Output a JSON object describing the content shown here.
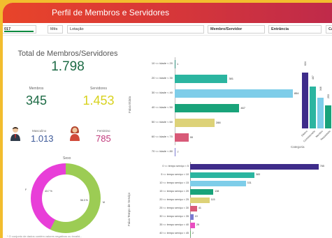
{
  "header": {
    "title": "Perfil de Membros e Servidores"
  },
  "filters": {
    "year_value": "017",
    "mes_label": "Mês",
    "lotacao_label": "Lotação",
    "membro_label": "Membro/Servidor",
    "entrancia_label": "Entrância",
    "cargo_label": "Ca"
  },
  "kpis": {
    "total_title": "Total de Membros/Servidores",
    "total_value": "1.798",
    "membros_label": "Membros",
    "membros_value": "345",
    "servidores_label": "Servidores",
    "servidores_value": "1.453",
    "masculino_label": "Masculino",
    "masculino_value": "1.013",
    "feminino_label": "Feminino",
    "feminino_value": "785"
  },
  "sexo": {
    "title": "Sexo",
    "f_label": "F",
    "m_label": "M",
    "f_pct": "43.7 %",
    "m_pct": "56.3 %",
    "colors": {
      "M": "#9ccc54",
      "F": "#e83ed8"
    }
  },
  "footnote": "* O conjunto de dados contém valores negativos ou invalid...",
  "chart_data": [
    {
      "type": "bar",
      "orientation": "horizontal",
      "ylabel": "Faixa Etária",
      "categories": [
        "10 <= idade < 20",
        "20 <= idade < 30",
        "30 <= idade < 40",
        "40 <= idade < 50",
        "50 <= idade < 60",
        "60 <= idade < 70",
        "70 <= idade < 80"
      ],
      "values": [
        1,
        381,
        854,
        467,
        288,
        99,
        7
      ],
      "colors": [
        "#2e8b7a",
        "#2bb5a0",
        "#7ecde9",
        "#19a37a",
        "#ddd278",
        "#d85a78",
        "#7a7ad0"
      ],
      "xlim": [
        0,
        860
      ]
    },
    {
      "type": "bar",
      "orientation": "horizontal",
      "ylabel": "Faixa Tempo de Serviço",
      "categories": [
        "0 <= tempo serviço < 5",
        "5 <= tempo serviço < 10",
        "10 <= tempo serviço < 15",
        "15 <= tempo serviço < 20",
        "20 <= tempo serviço < 25",
        "25 <= tempo serviço < 30",
        "30 <= tempo serviço < 35",
        "35 <= tempo serviço < 40",
        "40 <= tempo serviço < 45"
      ],
      "values": [
        765,
        383,
        331,
        138,
        115,
        41,
        19,
        29,
        2
      ],
      "colors": [
        "#3e2c8a",
        "#2bb5a0",
        "#7ecde9",
        "#19a37a",
        "#ddd278",
        "#d85a78",
        "#7a7ad0",
        "#e84ec0",
        "#6cae6c"
      ],
      "xlim": [
        0,
        770
      ]
    },
    {
      "type": "bar",
      "orientation": "vertical",
      "xlabel": "Categoria",
      "categories": [
        "Efetivo",
        "Comissionado",
        "Membro",
        "Requisitado",
        "C"
      ],
      "values": [
        624,
        467,
        346,
        253,
        200
      ],
      "value_labels": [
        "624",
        "467",
        "346",
        "253",
        ""
      ],
      "colors": [
        "#3e2c8a",
        "#2bb5a0",
        "#7ecde9",
        "#19a37a",
        "#1d6b45"
      ],
      "ylim": [
        0,
        700
      ]
    }
  ]
}
